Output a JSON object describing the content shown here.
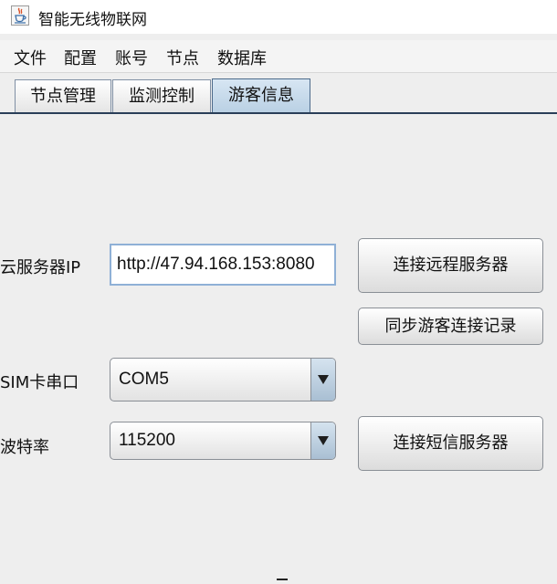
{
  "window": {
    "title": "智能无线物联网",
    "app_icon": "java-cup-icon"
  },
  "menu": [
    "文件",
    "配置",
    "账号",
    "节点",
    "数据库"
  ],
  "tabs": [
    {
      "label": "节点管理",
      "selected": false
    },
    {
      "label": "监测控制",
      "selected": false
    },
    {
      "label": "游客信息",
      "selected": true
    }
  ],
  "form": {
    "cloud_ip_label": "云服务器IP",
    "cloud_ip_value": "http://47.94.168.153:8080",
    "connect_remote_button": "连接远程服务器",
    "sync_button": "同步游客连接记录",
    "sim_port_label": "SIM卡串口",
    "sim_port_value": "COM5",
    "baud_label": "波特率",
    "baud_value": "115200",
    "connect_sms_button": "连接短信服务器"
  },
  "colors": {
    "selected_tab": "#c6d8ea",
    "tab_underline": "#2a3e58",
    "textfield_border": "#8fb0d6",
    "combo_arrow": "#b8cbdd"
  }
}
